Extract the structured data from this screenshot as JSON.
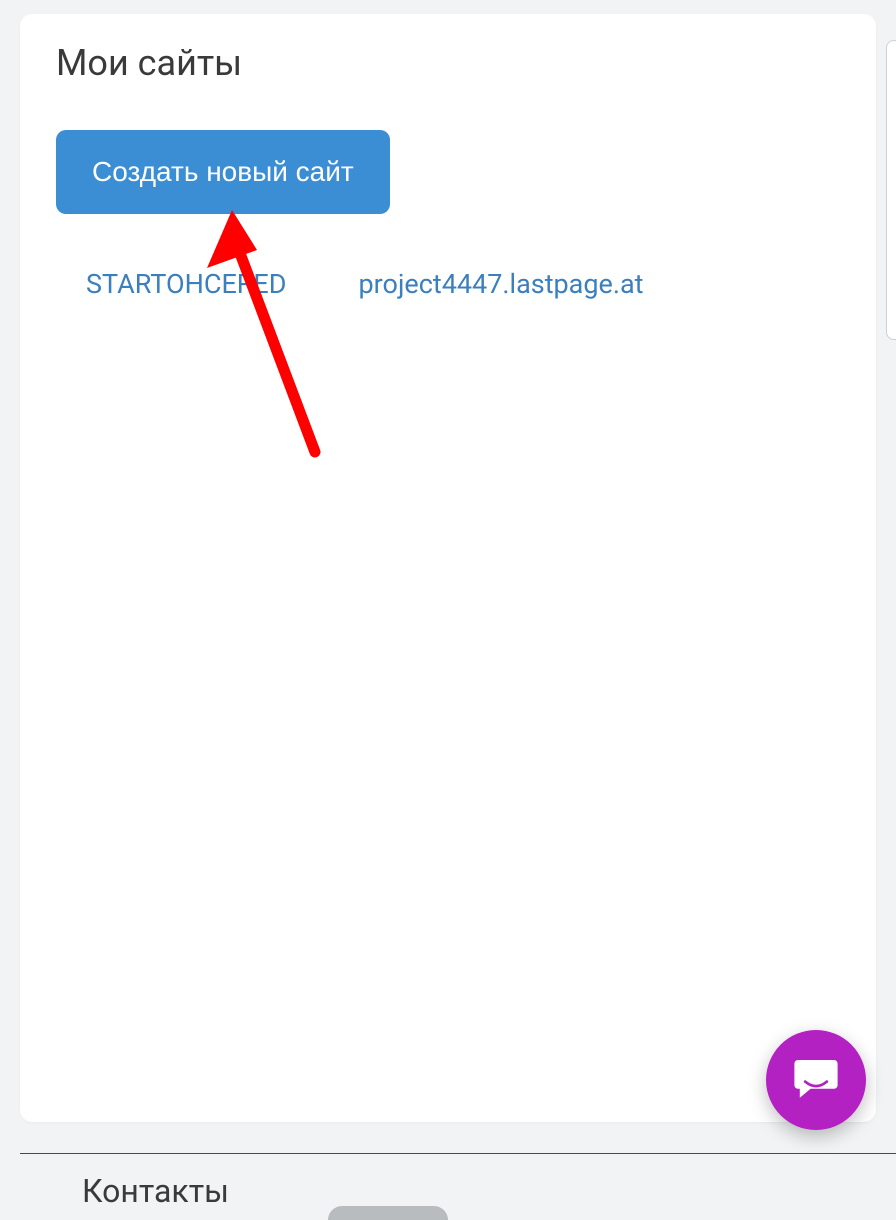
{
  "header": {
    "title": "Мои сайты"
  },
  "actions": {
    "create_label": "Создать новый сайт"
  },
  "sites": [
    {
      "name": "STARTOHCERED",
      "url": "project4447.lastpage.at"
    }
  ],
  "footer": {
    "contacts_label": "Контакты"
  },
  "annotation": {
    "arrow_color": "#ff0000"
  },
  "chat": {
    "color": "#b421c2"
  }
}
